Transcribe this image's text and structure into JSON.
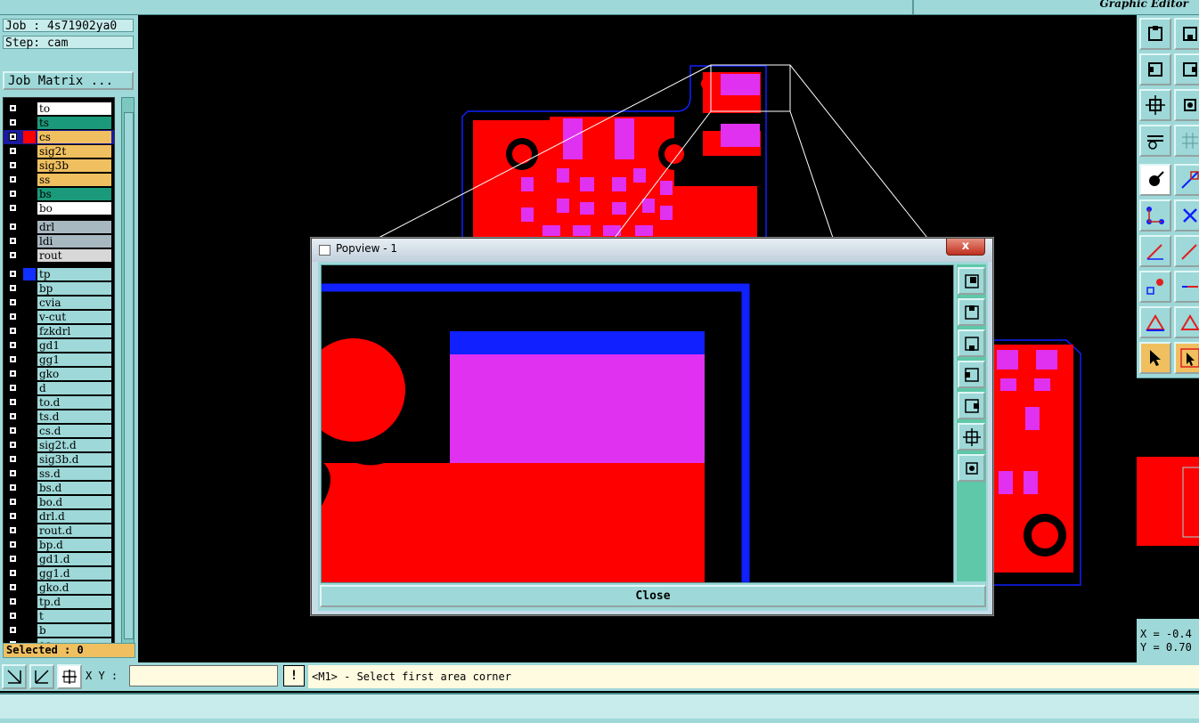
{
  "app": {
    "title": "Graphic Editor"
  },
  "job": {
    "job_text": "Job : 4s71902ya0",
    "step_text": "Step: cam",
    "matrix_label": "Job Matrix ..."
  },
  "layers": [
    {
      "name": "to",
      "color": "#ffffff"
    },
    {
      "name": "ts",
      "color": "#1a9a7a"
    },
    {
      "name": "cs",
      "color": "#f0c060",
      "active": true,
      "swatch": "#ff0000"
    },
    {
      "name": "sig2t",
      "color": "#f0c060"
    },
    {
      "name": "sig3b",
      "color": "#f0c060"
    },
    {
      "name": "ss",
      "color": "#f0c060"
    },
    {
      "name": "bs",
      "color": "#1a9a7a"
    },
    {
      "name": "bo",
      "color": "#ffffff"
    },
    {
      "name": "drl",
      "color": "#a8b8c0",
      "gap": true
    },
    {
      "name": "ldi",
      "color": "#a8b8c0"
    },
    {
      "name": "rout",
      "color": "#d8d8d8"
    },
    {
      "name": "tp",
      "color": "#9ed8d8",
      "gap": true,
      "swatch": "#1030ff"
    },
    {
      "name": "bp",
      "color": "#9ed8d8"
    },
    {
      "name": "cvia",
      "color": "#9ed8d8"
    },
    {
      "name": "v-cut",
      "color": "#9ed8d8"
    },
    {
      "name": "fzkdrl",
      "color": "#9ed8d8"
    },
    {
      "name": "gd1",
      "color": "#9ed8d8"
    },
    {
      "name": "gg1",
      "color": "#9ed8d8"
    },
    {
      "name": "gko",
      "color": "#9ed8d8"
    },
    {
      "name": "d",
      "color": "#9ed8d8"
    },
    {
      "name": "to.d",
      "color": "#9ed8d8"
    },
    {
      "name": "ts.d",
      "color": "#9ed8d8"
    },
    {
      "name": "cs.d",
      "color": "#9ed8d8"
    },
    {
      "name": "sig2t.d",
      "color": "#9ed8d8"
    },
    {
      "name": "sig3b.d",
      "color": "#9ed8d8"
    },
    {
      "name": "ss.d",
      "color": "#9ed8d8"
    },
    {
      "name": "bs.d",
      "color": "#9ed8d8"
    },
    {
      "name": "bo.d",
      "color": "#9ed8d8"
    },
    {
      "name": "drl.d",
      "color": "#9ed8d8"
    },
    {
      "name": "rout.d",
      "color": "#9ed8d8"
    },
    {
      "name": "bp.d",
      "color": "#9ed8d8"
    },
    {
      "name": "gd1.d",
      "color": "#9ed8d8"
    },
    {
      "name": "gg1.d",
      "color": "#9ed8d8"
    },
    {
      "name": "gko.d",
      "color": "#9ed8d8"
    },
    {
      "name": "tp.d",
      "color": "#9ed8d8"
    },
    {
      "name": "t",
      "color": "#9ed8d8"
    },
    {
      "name": "b",
      "color": "#9ed8d8"
    },
    {
      "name": "aa",
      "color": "#9ed8d8"
    }
  ],
  "selected_text": "Selected : 0",
  "popup": {
    "title": "Popview - 1",
    "close_x": "x",
    "close_label": "Close"
  },
  "coords": {
    "text": "X = -0.4\nY = 0.70"
  },
  "bottom": {
    "xy_label": "X Y :",
    "xy_value": "",
    "warn": "!",
    "prompt": "<M1> - Select first area corner"
  },
  "colors": {
    "panel": "#9ed8d8",
    "copper": "#ff0000",
    "pad": "#e030f0",
    "outline": "#1020ff",
    "active": "#f0c060"
  }
}
